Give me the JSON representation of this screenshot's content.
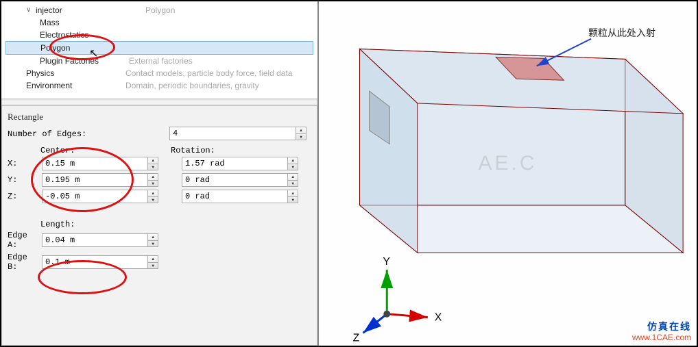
{
  "tree": {
    "injector": {
      "label": "injector",
      "desc": "Polygon"
    },
    "mass": {
      "label": "Mass",
      "desc": ""
    },
    "electrostatics": {
      "label": "Electrostatics",
      "desc": ""
    },
    "polygon": {
      "label": "Polygon",
      "desc": ""
    },
    "plugin": {
      "label": "Plugin Factories",
      "desc": "External factories"
    },
    "physics": {
      "label": "Physics",
      "desc": "Contact models, particle body force, field data"
    },
    "environment": {
      "label": "Environment",
      "desc": "Domain, periodic boundaries, gravity"
    }
  },
  "props": {
    "title": "Rectangle",
    "num_edges_label": "Number of Edges:",
    "num_edges": "4",
    "center_label": "Center:",
    "rotation_label": "Rotation:",
    "x_label": "X:",
    "y_label": "Y:",
    "z_label": "Z:",
    "x_val": "0.15 m",
    "y_val": "0.195 m",
    "z_val": "-0.05 m",
    "rot_x": "1.57 rad",
    "rot_y": "0 rad",
    "rot_z": "0 rad",
    "length_label": "Length:",
    "edge_a_label": "Edge A:",
    "edge_b_label": "Edge B:",
    "edge_a": "0.04 m",
    "edge_b": "0.1 m"
  },
  "viewport": {
    "annotation": "颗粒从此处入射",
    "watermark": "AE.C",
    "axes": {
      "x": "X",
      "y": "Y",
      "z": "Z"
    }
  },
  "branding": {
    "cn": "仿真在线",
    "url": "www.1CAE.com"
  }
}
